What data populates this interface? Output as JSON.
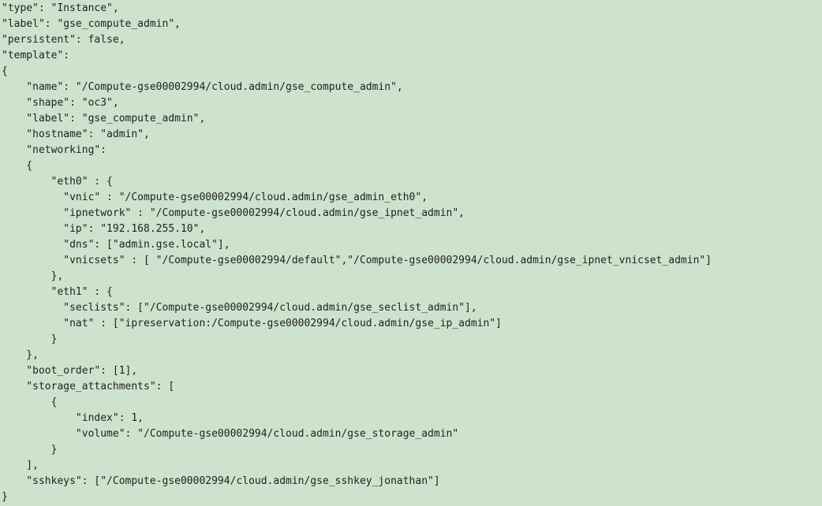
{
  "code": {
    "lines": [
      [
        "\"type\": \"Instance\","
      ],
      [
        "\"label\": \"gse_compute_admin\","
      ],
      [
        "\"persistent\": false,"
      ],
      [
        "\"template\":"
      ],
      [
        "{"
      ],
      [
        "    \"name\": \"/Compute-gse00002994/cloud.admin/gse_compute_admin\","
      ],
      [
        "    \"shape\": \"oc3\","
      ],
      [
        "    \"label\": \"gse_compute_admin\","
      ],
      [
        "    \"hostname\": \"admin\","
      ],
      [
        "    \"networking\":"
      ],
      [
        "    {"
      ],
      [
        "        \"eth0\" : {"
      ],
      [
        "          \"vnic\" : \"/Compute-gse00002994/cloud.admin/gse_admin_eth0\","
      ],
      [
        "          \"ipnetwork\" : \"/Compute-gse00002994/cloud.admin/gse_ipnet_admin\","
      ],
      [
        "          \"ip\": \"192.168.255.10\","
      ],
      [
        "          \"dns\": [\"admin.gse.local\"],"
      ],
      [
        "          \"vnicsets\" : [ \"/Compute-gse00002994/default\",\"/Compute-gse00002994/cloud.admin/gse_ipnet_vnicset_admin\"]"
      ],
      [
        "        },"
      ],
      [
        "        \"eth1\" : {"
      ],
      [
        "          \"seclists\": [\"/Compute-gse00002994/cloud.admin/gse_seclist_admin\"],"
      ],
      [
        "          \"nat\" : [\"ipreservation:/Compute-gse00002994/cloud.admin/gse_ip_admin\"]"
      ],
      [
        "        }"
      ],
      [
        "    },"
      ],
      [
        "    \"boot_order\": [1],"
      ],
      [
        "    \"storage_attachments\": ["
      ],
      [
        "        {"
      ],
      [
        "            \"index\": 1,"
      ],
      [
        "            \"volume\": \"/Compute-gse00002994/cloud.admin/gse_storage_admin\""
      ],
      [
        "        }"
      ],
      [
        "    ],"
      ],
      [
        "    \"sshkeys\": [\"/Compute-gse00002994/cloud.admin/gse_sshkey_jonathan\"]"
      ],
      [
        "}"
      ]
    ]
  }
}
